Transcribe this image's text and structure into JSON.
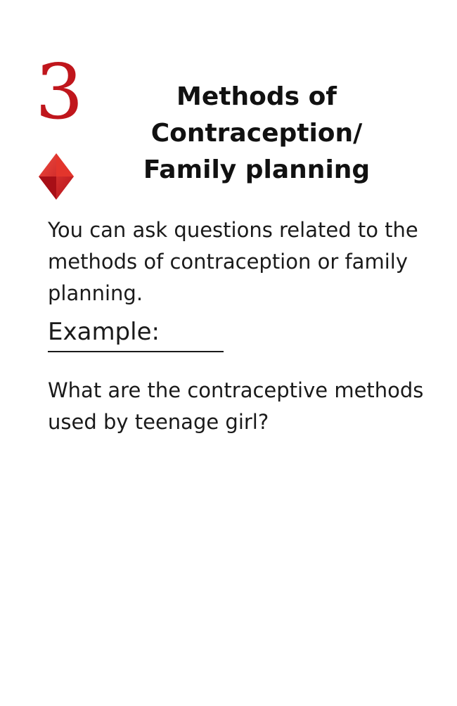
{
  "card": {
    "rank": "3",
    "suit_icon": "diamond-icon",
    "accent_color": "#c0161c",
    "title_lines": [
      "Methods of",
      "Contraception/",
      "Family planning"
    ],
    "description": "You can ask questions related to the methods of contraception or family planning.",
    "example_heading": "Example:",
    "example_text": "What are the contraceptive methods used by teenage girl?"
  }
}
